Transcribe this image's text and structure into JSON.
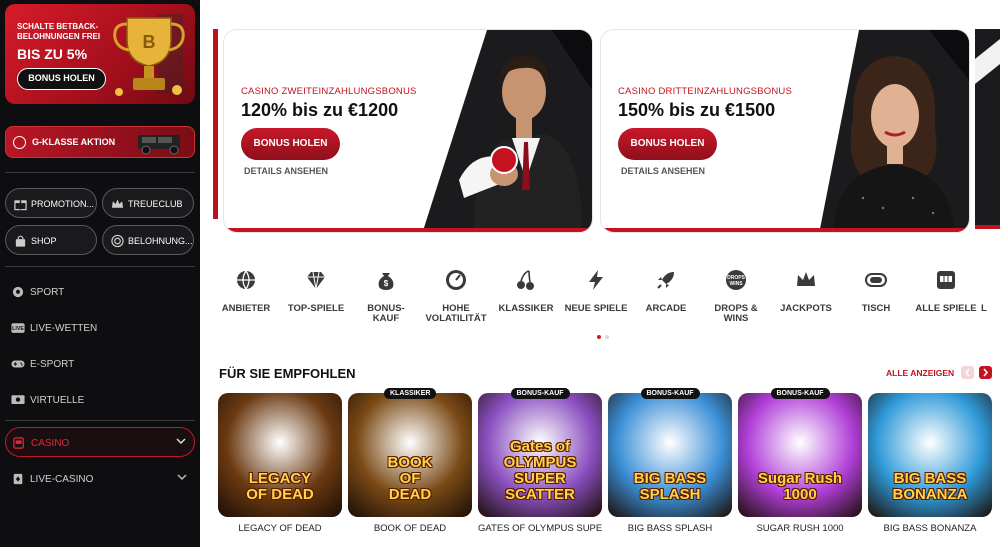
{
  "sidebar": {
    "promo": {
      "line1": "SCHALTE BETBACK-",
      "line2": "BELOHNUNGEN FREI",
      "headline": "BIS ZU 5%",
      "button": "BONUS HOLEN"
    },
    "gklasse": "G-KLASSE AKTION",
    "pills": [
      "PROMOTION...",
      "TREUECLUB",
      "SHOP",
      "BELOHNUNG..."
    ],
    "nav": [
      {
        "label": "SPORT",
        "icon": "soccer-ball-icon"
      },
      {
        "label": "LIVE-WETTEN",
        "icon": "live-icon"
      },
      {
        "label": "E-SPORT",
        "icon": "gamepad-icon"
      },
      {
        "label": "VIRTUELLE",
        "icon": "virtual-icon"
      },
      {
        "label": "CASINO",
        "icon": "slot-machine-icon"
      },
      {
        "label": "LIVE-CASINO",
        "icon": "card-icon"
      }
    ]
  },
  "banners": [
    {
      "subtitle": "CASINO ZWEITEINZAHLUNGSBONUS",
      "headline": "120% bis zu €1200",
      "button": "BONUS HOLEN",
      "details": "DETAILS ANSEHEN"
    },
    {
      "subtitle": "CASINO DRITTEINZAHLUNGSBONUS",
      "headline": "150% bis zu €1500",
      "button": "BONUS HOLEN",
      "details": "DETAILS ANSEHEN"
    }
  ],
  "categories": [
    {
      "label": "ANBIETER",
      "icon": "provider-globe-icon"
    },
    {
      "label": "TOP-SPIELE",
      "icon": "diamond-icon"
    },
    {
      "label": "BONUS-\nKAUF",
      "icon": "money-bag-icon"
    },
    {
      "label": "HOHE\nVOLATILITÄT",
      "icon": "gauge-icon"
    },
    {
      "label": "KLASSIKER",
      "icon": "cherry-icon"
    },
    {
      "label": "NEUE SPIELE",
      "icon": "lightning-icon"
    },
    {
      "label": "ARCADE",
      "icon": "rocket-icon"
    },
    {
      "label": "DROPS &\nWINS",
      "icon": "drops-wins-icon"
    },
    {
      "label": "JACKPOTS",
      "icon": "crown-icon"
    },
    {
      "label": "TISCH",
      "icon": "table-chip-icon"
    },
    {
      "label": "ALLE SPIELE",
      "icon": "slot-machine-icon"
    },
    {
      "label": "L",
      "icon": "more-icon"
    }
  ],
  "recommended": {
    "title": "FÜR SIE EMPFOHLEN",
    "show_all": "ALLE ANZEIGEN",
    "games": [
      {
        "name": "LEGACY OF DEAD",
        "art": "LEGACY\nOF DEAD",
        "badge": "",
        "bg": "#6b3a12"
      },
      {
        "name": "BOOK OF DEAD",
        "art": "BOOK\nOF\nDEAD",
        "badge": "KLASSIKER",
        "bg": "#7a4a16"
      },
      {
        "name": "GATES OF OLYMPUS SUPE...",
        "art": "Gates of\nOLYMPUS\nSUPER SCATTER",
        "badge": "BONUS-KAUF",
        "bg": "#8a4fbf"
      },
      {
        "name": "BIG BASS SPLASH",
        "art": "BIG BASS\nSPLASH",
        "badge": "BONUS-KAUF",
        "bg": "#3b8fd6"
      },
      {
        "name": "SUGAR RUSH 1000",
        "art": "Sugar Rush\n1000",
        "badge": "BONUS-KAUF",
        "bg": "#b03fd8"
      },
      {
        "name": "BIG BASS BONANZA",
        "art": "BIG BASS\nBONANZA",
        "badge": "",
        "bg": "#2f9ad8"
      }
    ]
  },
  "colors": {
    "accent": "#c5121f",
    "sidebar_bg": "#0e0e10"
  }
}
